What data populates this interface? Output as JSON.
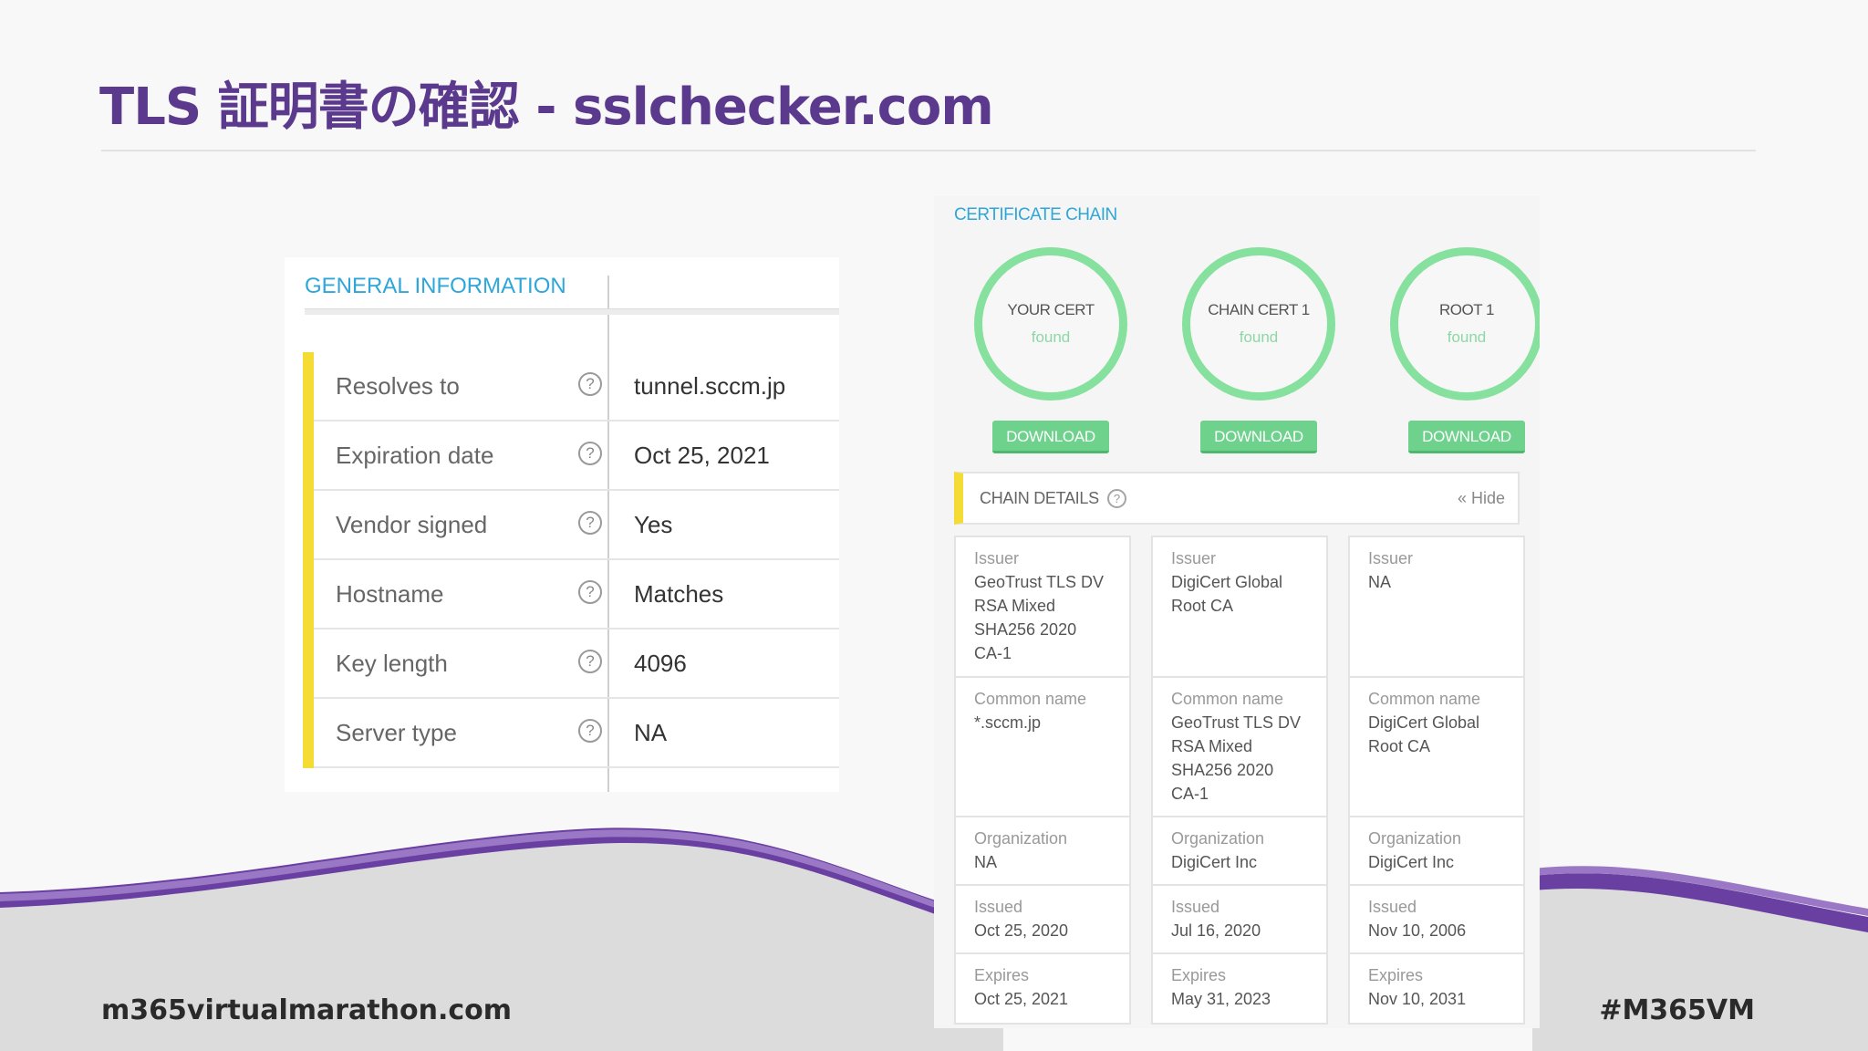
{
  "slide": {
    "title": "TLS 証明書の確認 - sslchecker.com",
    "footer_left": "m365virtualmarathon.com",
    "footer_right": "#M365VM"
  },
  "colors": {
    "title": "#5b3a8e",
    "accent_blue": "#2ea7d8",
    "accent_yellow": "#f5dc35",
    "ring_green": "#86e09e",
    "button_green": "#6ed28d",
    "wave_purple": "#6a3fa2"
  },
  "general_info": {
    "header": "GENERAL INFORMATION",
    "groups": [
      [
        {
          "label": "Resolves to",
          "value": "tunnel.sccm.jp"
        },
        {
          "label": "Expiration date",
          "value": "Oct 25, 2021"
        },
        {
          "label": "Vendor signed",
          "value": "Yes"
        }
      ],
      [
        {
          "label": "Hostname",
          "value": "Matches"
        },
        {
          "label": "Key length",
          "value": "4096"
        },
        {
          "label": "Server type",
          "value": "NA"
        }
      ]
    ],
    "help_icon": "question-circle-icon",
    "help_glyph": "?"
  },
  "chain": {
    "title": "CERTIFICATE CHAIN",
    "download_label": "DOWNLOAD",
    "certs": [
      {
        "name": "YOUR CERT",
        "status": "found"
      },
      {
        "name": "CHAIN CERT 1",
        "status": "found"
      },
      {
        "name": "ROOT 1",
        "status": "found"
      }
    ],
    "details_label": "CHAIN DETAILS",
    "details_help": "?",
    "hide_label": "« Hide",
    "columns": [
      {
        "issuer": {
          "k": "Issuer",
          "v": "GeoTrust TLS DV\nRSA Mixed\nSHA256 2020\nCA-1"
        },
        "common_name": {
          "k": "Common name",
          "v": "*.sccm.jp"
        },
        "organization": {
          "k": "Organization",
          "v": "NA"
        },
        "issued": {
          "k": "Issued",
          "v": "Oct 25, 2020"
        },
        "expires": {
          "k": "Expires",
          "v": "Oct 25, 2021"
        }
      },
      {
        "issuer": {
          "k": "Issuer",
          "v": "DigiCert Global\nRoot CA"
        },
        "common_name": {
          "k": "Common name",
          "v": "GeoTrust TLS DV\nRSA Mixed\nSHA256 2020\nCA-1"
        },
        "organization": {
          "k": "Organization",
          "v": "DigiCert Inc"
        },
        "issued": {
          "k": "Issued",
          "v": "Jul 16, 2020"
        },
        "expires": {
          "k": "Expires",
          "v": "May 31, 2023"
        }
      },
      {
        "issuer": {
          "k": "Issuer",
          "v": "NA"
        },
        "common_name": {
          "k": "Common name",
          "v": "DigiCert Global\nRoot CA"
        },
        "organization": {
          "k": "Organization",
          "v": "DigiCert Inc"
        },
        "issued": {
          "k": "Issued",
          "v": "Nov 10, 2006"
        },
        "expires": {
          "k": "Expires",
          "v": "Nov 10, 2031"
        }
      }
    ]
  }
}
